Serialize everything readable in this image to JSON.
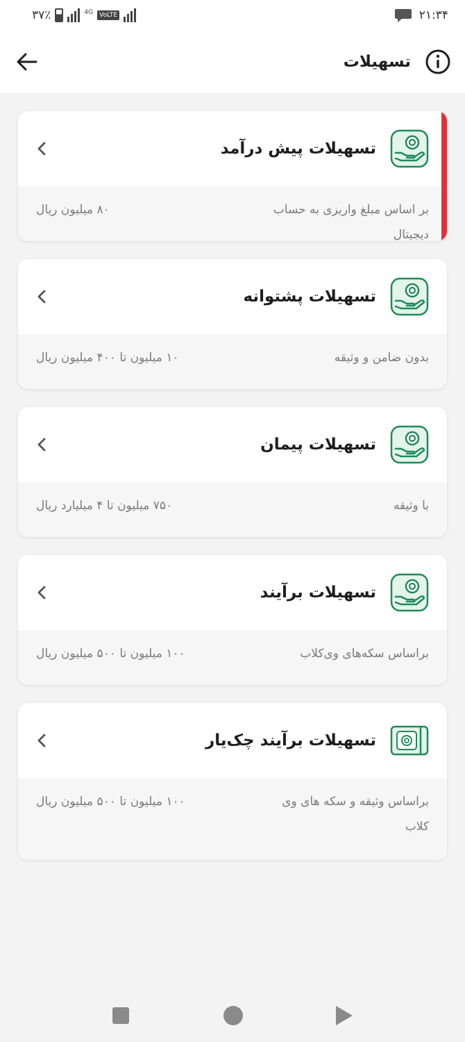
{
  "status_bar": {
    "battery": "۳۷٪",
    "network": "4G",
    "lte": "VoLTE",
    "time": "۲۱:۳۴"
  },
  "header": {
    "title": "تسهیلات"
  },
  "cards": [
    {
      "title": "تسهیلات پیش درآمد",
      "description": "بر اساس مبلغ واریزی به حساب دیجیتال",
      "amount": "۸۰ میلیون ریال",
      "highlighted": true,
      "icon": "coin-hand-icon"
    },
    {
      "title": "تسهیلات پشتوانه",
      "description": "بدون ضامن و وثیقه",
      "amount": "۱۰ میلیون تا ۴۰۰ میلیون ریال",
      "icon": "coin-hand-icon"
    },
    {
      "title": "تسهیلات پیمان",
      "description": "با وثیقه",
      "amount": "۷۵۰ میلیون تا ۴ میلیارد ریال",
      "icon": "coin-hand-icon"
    },
    {
      "title": "تسهیلات برآیند",
      "description": "براساس سکه‌های وی‌کلاب",
      "amount": "۱۰۰ میلیون تا ۵۰۰ میلیون ریال",
      "icon": "coin-hand-icon"
    },
    {
      "title": "تسهیلات برآیند چک‌یار",
      "description": "براساس وثیقه و سکه های وی کلاب",
      "amount": "۱۰۰ میلیون تا ۵۰۰ میلیون ریال",
      "icon": "cheque-icon"
    }
  ],
  "colors": {
    "accent_red": "#e0313a",
    "icon_green": "#1f8a5a",
    "icon_bg": "#e3f4ea"
  }
}
